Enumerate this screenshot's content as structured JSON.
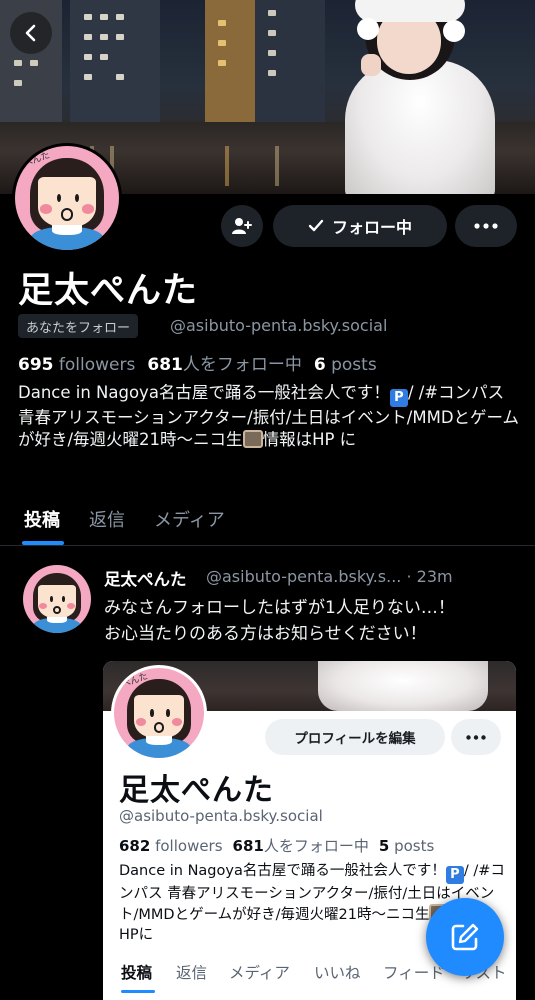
{
  "profile": {
    "display_name": "足太ぺんた",
    "follows_you_badge": "あなたをフォロー",
    "handle": "@asibuto-penta.bsky.social",
    "followers_count": "695",
    "followers_label": "followers",
    "following_count": "681",
    "following_label": "人をフォロー中",
    "posts_count": "6",
    "posts_label": "posts",
    "bio_part1": "Dance in Nagoya名古屋で踊る一般社会人です！",
    "bio_emoji_p": "P",
    "bio_part2": "/ /#コンパス 青春アリスモーションアクター/振付/土日はイベント/MMDとゲームが好き/毎週火曜21時〜ニコ生",
    "bio_part3": "情報はHP に",
    "avatar_tag": "ぺんた"
  },
  "actions": {
    "follow_label": "フォロー中",
    "add_user_icon": "person-plus-icon",
    "more_icon": "ellipsis-icon",
    "back_icon": "chevron-left-icon"
  },
  "tabs": [
    {
      "label": "投稿",
      "active": true
    },
    {
      "label": "返信",
      "active": false
    },
    {
      "label": "メディア",
      "active": false
    }
  ],
  "post": {
    "author_name": "足太ぺんた",
    "author_handle": "@asibuto-penta.bsky.s...",
    "separator": "·",
    "time": "23m",
    "text_line1": "みなさんフォローしたはずが1人足りない…！",
    "text_line2": "お心当たりのある方はお知らせください！"
  },
  "embed": {
    "edit_profile_label": "プロフィールを編集",
    "display_name": "足太ぺんた",
    "handle": "@asibuto-penta.bsky.social",
    "followers_count": "682",
    "followers_label": "followers",
    "following_count": "681",
    "following_label": "人をフォロー中",
    "posts_count": "5",
    "posts_label": "posts",
    "bio_part1": "Dance in Nagoya名古屋で踊る一般社会人です！",
    "bio_emoji_p": "P",
    "bio_part2": "/ /#コンパス 青春アリスモーションアクター/振付/土日はイベント/MMDとゲームが好き/毎週火曜21時〜ニコ生",
    "bio_part3": "情報はHPに",
    "tabs": [
      "投稿",
      "返信",
      "メディア",
      "いいね",
      "フィード",
      "リスト"
    ]
  },
  "colors": {
    "accent": "#208bfe",
    "background": "#000000",
    "muted_text": "#8b96a3",
    "button_bg": "#1e2329"
  },
  "fab_icon": "compose-icon"
}
